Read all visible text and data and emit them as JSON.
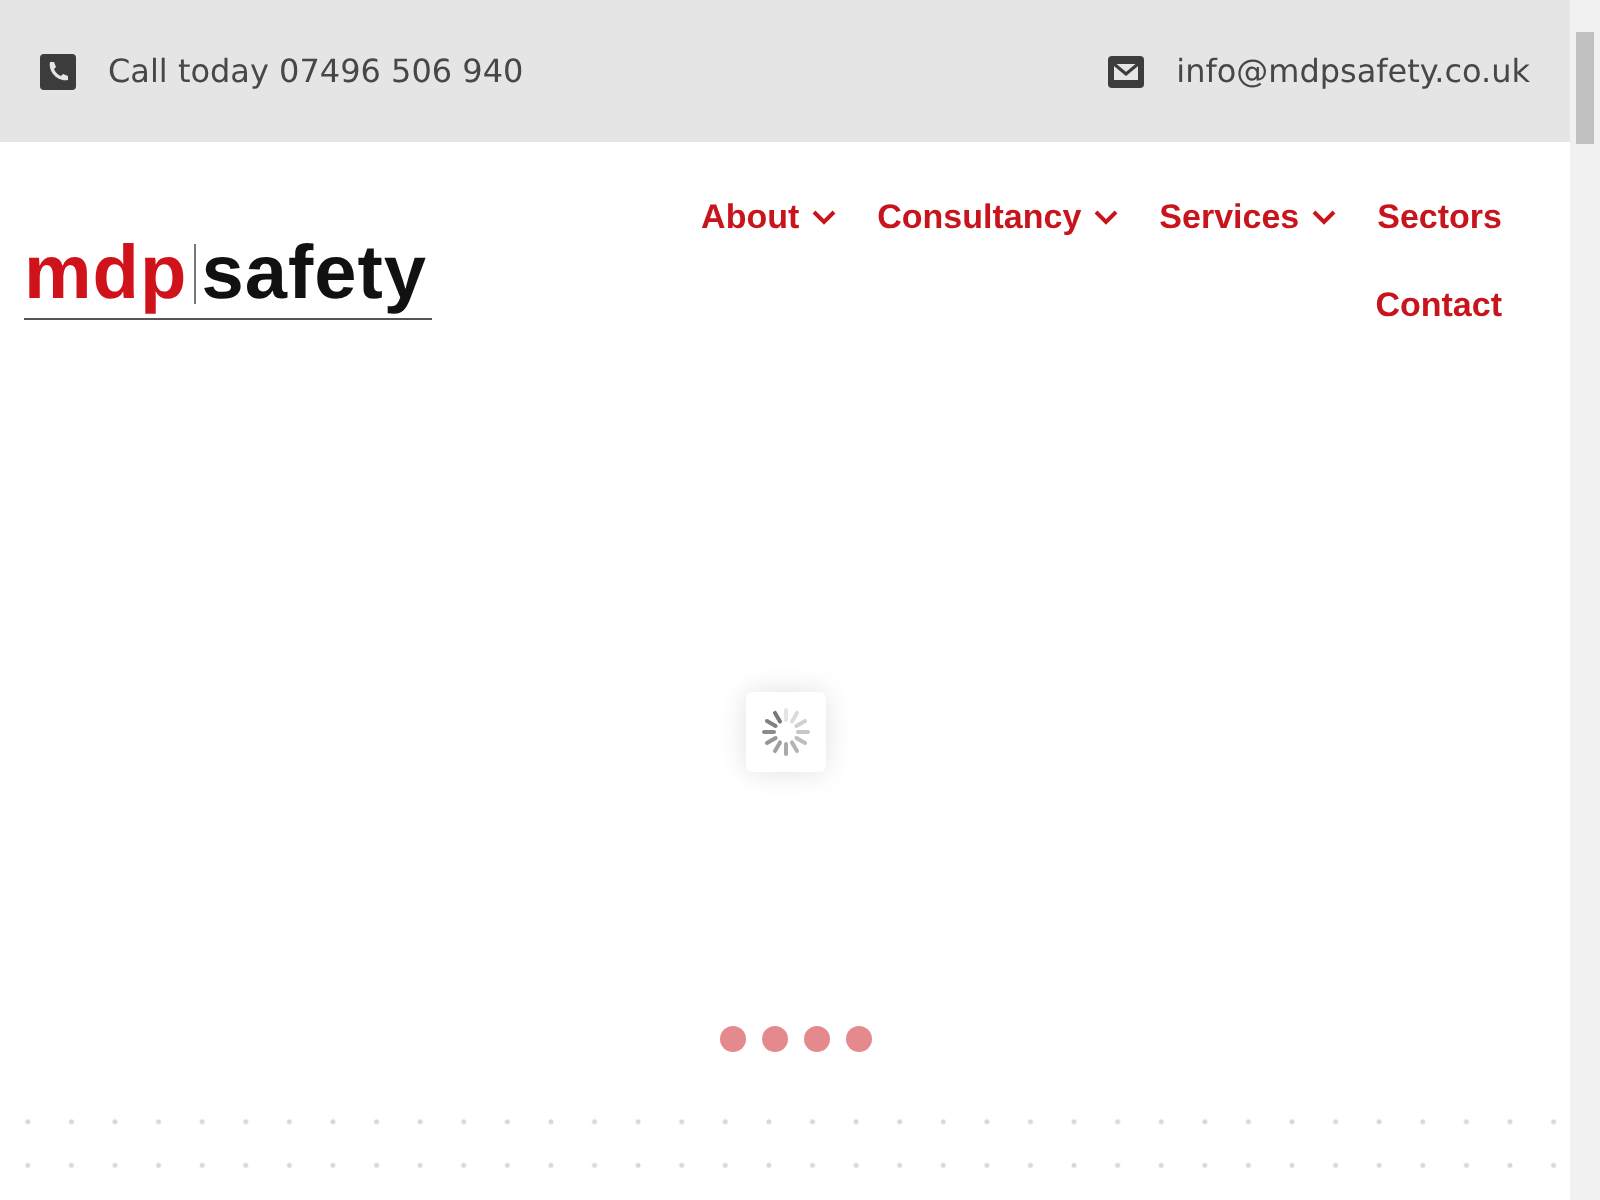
{
  "top_bar": {
    "phone": "Call today 07496 506 940",
    "email": "info@mdpsafety.co.uk"
  },
  "logo": {
    "first": "mdp",
    "second": "safety"
  },
  "nav": [
    {
      "label": "About",
      "has_submenu": true
    },
    {
      "label": "Consultancy",
      "has_submenu": true
    },
    {
      "label": "Services",
      "has_submenu": true
    },
    {
      "label": "Sectors",
      "has_submenu": false
    },
    {
      "label": "Contact",
      "has_submenu": false
    }
  ],
  "slider": {
    "dots": [
      {
        "kind": "dot"
      },
      {
        "kind": "dot"
      },
      {
        "kind": "dot"
      },
      {
        "kind": "dot"
      }
    ]
  }
}
